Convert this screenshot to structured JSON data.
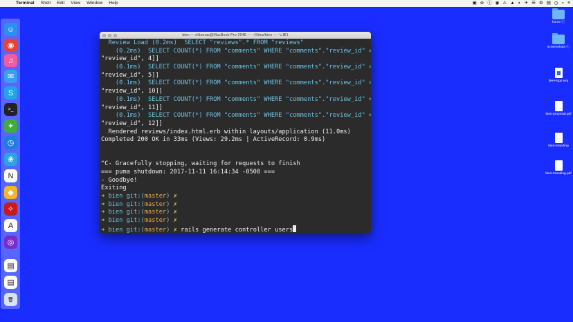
{
  "menubar": {
    "apple": "",
    "items": [
      "Terminal",
      "Shell",
      "Edit",
      "View",
      "Window",
      "Help"
    ],
    "status": [
      "▣",
      "⊕",
      "ⓘ",
      "◉",
      "⚠",
      "▲",
      "◐",
      "✈",
      "☰",
      "⚙",
      "▤",
      "◷",
      "⌕",
      "≡"
    ]
  },
  "terminal": {
    "title": "bien — riklomas@MacBook-Pro-2948 — ~/Sites/bien — ⌥⌘1",
    "lines": [
      {
        "parts": [
          {
            "t": "  Review Load (0.2ms)  ",
            "c": "c-cyan"
          },
          {
            "t": "SELECT \"reviews\".* FROM \"reviews\"",
            "c": "c-cyan"
          }
        ]
      },
      {
        "parts": [
          {
            "t": "    (0.2ms)  SELECT COUNT(*) FROM \"comments\" WHERE \"comments\".\"review_id\" = ?  [[",
            "c": "c-cyan"
          }
        ]
      },
      {
        "parts": [
          {
            "t": "\"review_id\", 4]]",
            "c": "c-white"
          }
        ]
      },
      {
        "parts": [
          {
            "t": "    (0.1ms)  SELECT COUNT(*) FROM \"comments\" WHERE \"comments\".\"review_id\" = ?  [[",
            "c": "c-cyan"
          }
        ]
      },
      {
        "parts": [
          {
            "t": "\"review_id\", 5]]",
            "c": "c-white"
          }
        ]
      },
      {
        "parts": [
          {
            "t": "    (0.1ms)  SELECT COUNT(*) FROM \"comments\" WHERE \"comments\".\"review_id\" = ?  [[",
            "c": "c-cyan"
          }
        ]
      },
      {
        "parts": [
          {
            "t": "\"review_id\", 10]]",
            "c": "c-white"
          }
        ]
      },
      {
        "parts": [
          {
            "t": "    (0.1ms)  SELECT COUNT(*) FROM \"comments\" WHERE \"comments\".\"review_id\" = ?  [[",
            "c": "c-cyan"
          }
        ]
      },
      {
        "parts": [
          {
            "t": "\"review_id\", 11]]",
            "c": "c-white"
          }
        ]
      },
      {
        "parts": [
          {
            "t": "    (0.1ms)  SELECT COUNT(*) FROM \"comments\" WHERE \"comments\".\"review_id\" = ?  [[",
            "c": "c-cyan"
          }
        ]
      },
      {
        "parts": [
          {
            "t": "\"review_id\", 12]]",
            "c": "c-white"
          }
        ]
      },
      {
        "parts": [
          {
            "t": "  Rendered reviews/index.html.erb within layouts/application (11.0ms)",
            "c": "c-white"
          }
        ]
      },
      {
        "parts": [
          {
            "t": "Completed 200 OK in 33ms (Views: 29.2ms | ActiveRecord: 0.9ms)",
            "c": "c-white"
          }
        ]
      },
      {
        "parts": [
          {
            "t": "",
            "c": "c-white"
          }
        ]
      },
      {
        "parts": [
          {
            "t": "",
            "c": "c-white"
          }
        ]
      },
      {
        "parts": [
          {
            "t": "^C- Gracefully stopping, waiting for requests to finish",
            "c": "c-white"
          }
        ]
      },
      {
        "parts": [
          {
            "t": "=== puma shutdown: 2017-11-11 16:14:34 -0500 ===",
            "c": "c-white"
          }
        ]
      },
      {
        "parts": [
          {
            "t": "- Goodbye!",
            "c": "c-white"
          }
        ]
      },
      {
        "parts": [
          {
            "t": "Exiting",
            "c": "c-white"
          }
        ]
      },
      {
        "parts": [
          {
            "t": "➜ ",
            "c": "c-green"
          },
          {
            "t": "bien ",
            "c": "c-cyan"
          },
          {
            "t": "git:(",
            "c": "c-cyan"
          },
          {
            "t": "master",
            "c": "c-orange"
          },
          {
            "t": ") ",
            "c": "c-cyan"
          },
          {
            "t": "✗",
            "c": "c-yellow"
          }
        ]
      },
      {
        "parts": [
          {
            "t": "➜ ",
            "c": "c-green"
          },
          {
            "t": "bien ",
            "c": "c-cyan"
          },
          {
            "t": "git:(",
            "c": "c-cyan"
          },
          {
            "t": "master",
            "c": "c-orange"
          },
          {
            "t": ") ",
            "c": "c-cyan"
          },
          {
            "t": "✗",
            "c": "c-yellow"
          }
        ]
      },
      {
        "parts": [
          {
            "t": "➜ ",
            "c": "c-green"
          },
          {
            "t": "bien ",
            "c": "c-cyan"
          },
          {
            "t": "git:(",
            "c": "c-cyan"
          },
          {
            "t": "master",
            "c": "c-orange"
          },
          {
            "t": ") ",
            "c": "c-cyan"
          },
          {
            "t": "✗",
            "c": "c-yellow"
          }
        ]
      },
      {
        "parts": [
          {
            "t": "➜ ",
            "c": "c-green"
          },
          {
            "t": "bien ",
            "c": "c-cyan"
          },
          {
            "t": "git:(",
            "c": "c-cyan"
          },
          {
            "t": "master",
            "c": "c-orange"
          },
          {
            "t": ") ",
            "c": "c-cyan"
          },
          {
            "t": "✗",
            "c": "c-yellow"
          }
        ]
      },
      {
        "parts": [
          {
            "t": "➜ ",
            "c": "c-green"
          },
          {
            "t": "bien ",
            "c": "c-cyan"
          },
          {
            "t": "git:(",
            "c": "c-cyan"
          },
          {
            "t": "master",
            "c": "c-orange"
          },
          {
            "t": ") ",
            "c": "c-cyan"
          },
          {
            "t": "✗ ",
            "c": "c-yellow"
          },
          {
            "t": "rails generate controller users",
            "c": "c-white"
          }
        ],
        "cursor": true
      }
    ]
  },
  "dock": {
    "icons": [
      {
        "name": "finder-icon",
        "color": "#2d8ff0",
        "glyph": "☺"
      },
      {
        "name": "chrome-icon",
        "color": "#e94235",
        "glyph": "◉"
      },
      {
        "name": "itunes-icon",
        "color": "#f35aa0",
        "glyph": "♫"
      },
      {
        "name": "messages-icon",
        "color": "#3a9ef5",
        "glyph": "✉"
      },
      {
        "name": "skype-icon",
        "color": "#1fa5e8",
        "glyph": "S"
      },
      {
        "name": "terminal-icon",
        "color": "#222222",
        "glyph": ">_"
      },
      {
        "name": "safari-icon",
        "color": "#3fae3a",
        "glyph": "✦"
      },
      {
        "name": "clock-icon",
        "color": "#1e7de0",
        "glyph": "◷"
      },
      {
        "name": "tweetbot-icon",
        "color": "#2aa4e6",
        "glyph": "❀"
      },
      {
        "name": "notion-icon",
        "color": "#ffffff",
        "glyph": "N"
      },
      {
        "name": "sketch-icon",
        "color": "#f7b52c",
        "glyph": "◆"
      },
      {
        "name": "acrobat-icon",
        "color": "#c8191b",
        "glyph": "✧"
      },
      {
        "name": "affinity-icon",
        "color": "#ffffff",
        "glyph": "A"
      },
      {
        "name": "dvd-player-icon",
        "color": "#7a2cc8",
        "glyph": "◎"
      },
      {
        "name": "document-icon",
        "color": "#ffffff",
        "glyph": "▤"
      },
      {
        "name": "document-icon-2",
        "color": "#ffffff",
        "glyph": "▤"
      },
      {
        "name": "trash-icon",
        "color": "#d9e2f2",
        "glyph": "🗑"
      }
    ]
  },
  "desktop": {
    "items": [
      {
        "label": "home ⓘ",
        "type": "folder"
      },
      {
        "label": "screenshots ⓘ",
        "type": "folder"
      },
      {
        "label": "bien-logo.svg",
        "type": "doc"
      },
      {
        "label": "bien-proposal.pdf",
        "type": "doc"
      },
      {
        "label": "bien-branding",
        "type": "doc"
      },
      {
        "label": "bien-branding.pdf",
        "type": "doc"
      }
    ]
  }
}
